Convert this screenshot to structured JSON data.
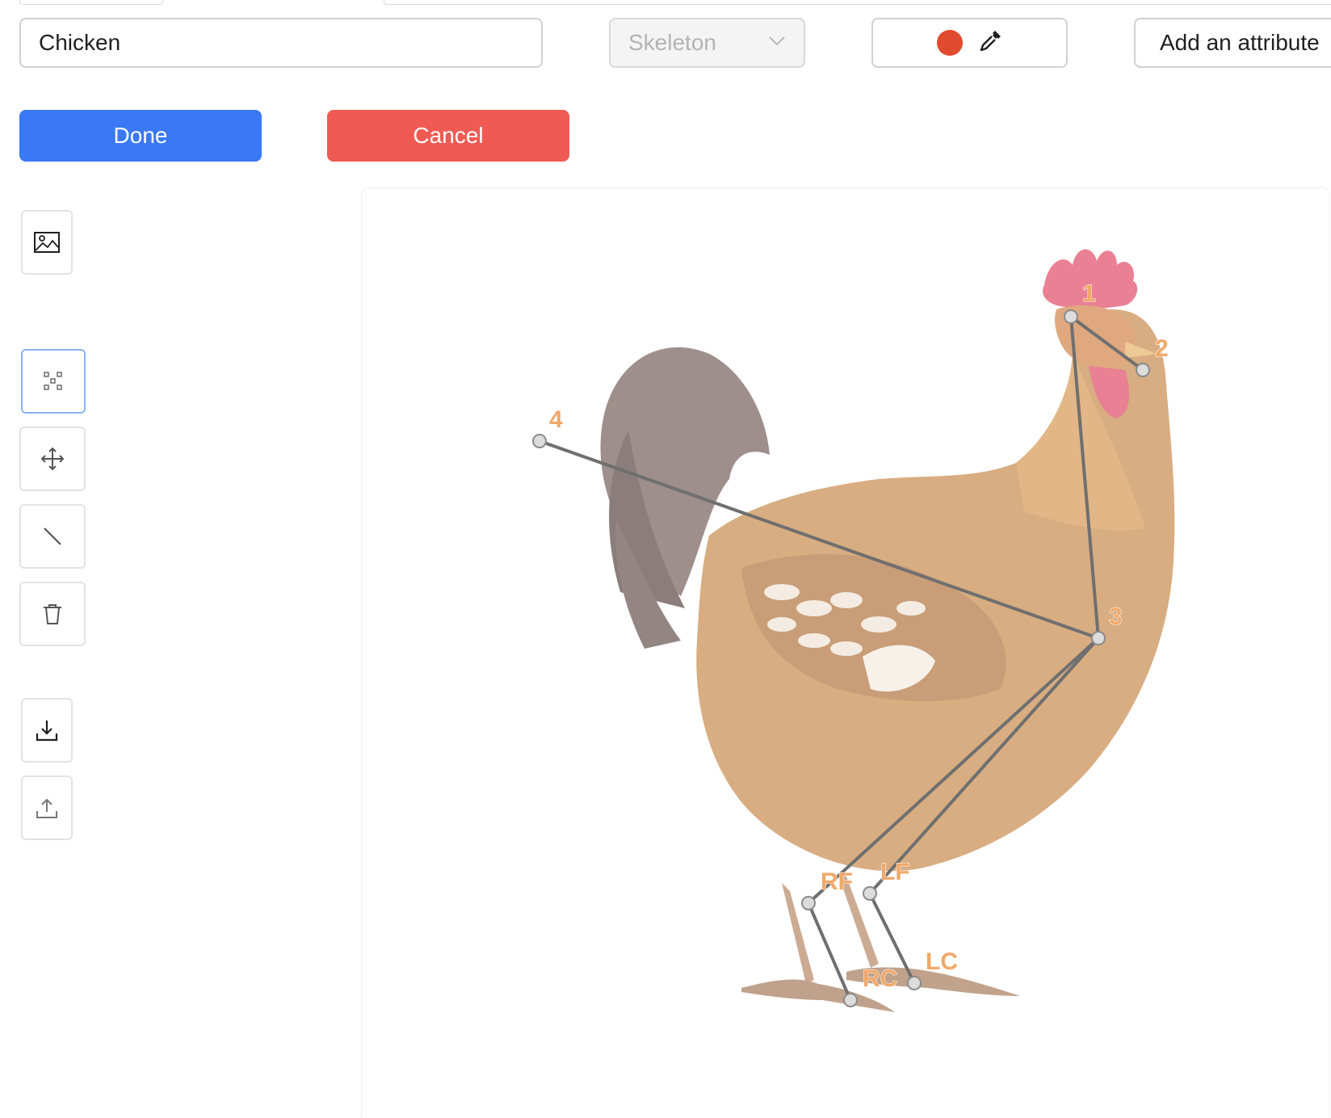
{
  "form": {
    "label_value": "Chicken",
    "type_select": {
      "value": "Skeleton",
      "disabled": true
    },
    "color": {
      "swatch": "#e04a2e",
      "icon": "eyedropper-icon"
    },
    "add_attribute_label": "Add an attribute"
  },
  "actions": {
    "done_label": "Done",
    "done_color": "#3a78f5",
    "cancel_label": "Cancel",
    "cancel_color": "#ef5a52"
  },
  "toolbar": {
    "tools": [
      {
        "name": "image-icon",
        "label": "Image"
      },
      {
        "name": "keypoints-icon",
        "label": "Points",
        "active": true
      },
      {
        "name": "move-icon",
        "label": "Move"
      },
      {
        "name": "line-icon",
        "label": "Edge"
      },
      {
        "name": "trash-icon",
        "label": "Delete"
      },
      {
        "name": "download-icon",
        "label": "Download"
      },
      {
        "name": "upload-icon",
        "label": "Upload"
      }
    ]
  },
  "skeleton": {
    "keypoints": [
      {
        "id": "1",
        "label": "1"
      },
      {
        "id": "2",
        "label": "2"
      },
      {
        "id": "3",
        "label": "3"
      },
      {
        "id": "4",
        "label": "4"
      },
      {
        "id": "RF",
        "label": "RF"
      },
      {
        "id": "LF",
        "label": "LF"
      },
      {
        "id": "RC",
        "label": "RC"
      },
      {
        "id": "LC",
        "label": "LC"
      }
    ],
    "edges": [
      [
        "1",
        "2"
      ],
      [
        "1",
        "3"
      ],
      [
        "3",
        "4"
      ],
      [
        "3",
        "RF"
      ],
      [
        "3",
        "LF"
      ],
      [
        "RF",
        "RC"
      ],
      [
        "LF",
        "LC"
      ]
    ],
    "edge_color": "#6f6f6f",
    "point_fill": "#dcdcdc",
    "label_color": "#f0a869",
    "image_subject": "rooster"
  }
}
